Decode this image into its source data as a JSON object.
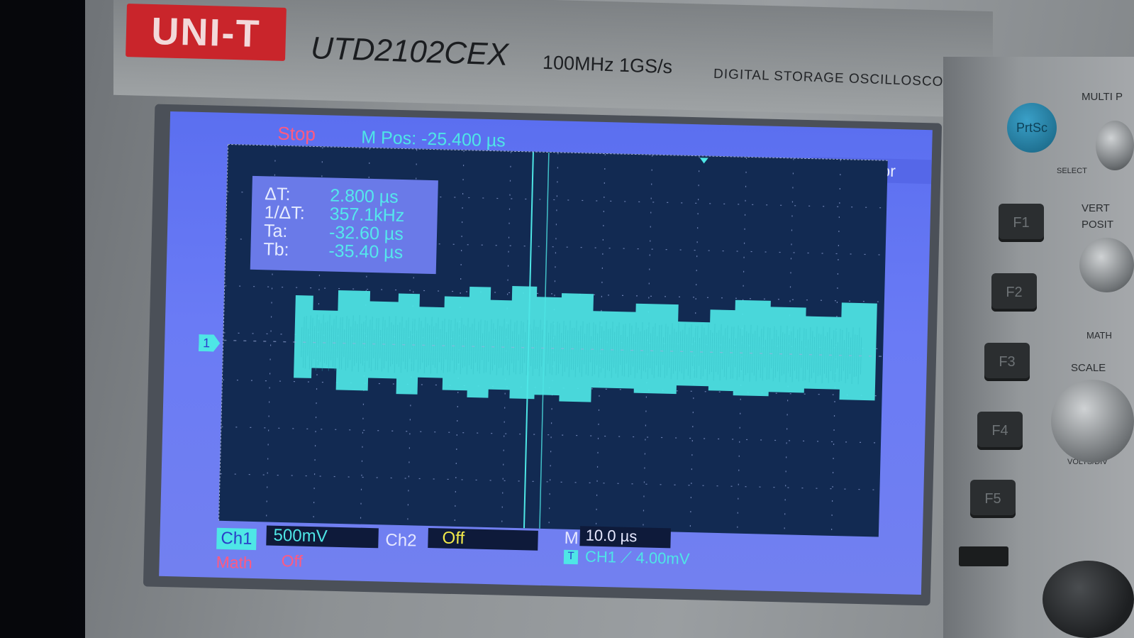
{
  "brand": {
    "logo": "UNI-T",
    "model": "UTD2102CEX",
    "spec": "100MHz  1GS/s",
    "description": "DIGITAL STORAGE OSCILLOSCOPE"
  },
  "screen": {
    "status": "Stop",
    "mpos": "M Pos: -25.400 µs",
    "cursor_tab": "Cursor",
    "readout": {
      "dt_label": "ΔT:",
      "dt_value": "2.800 µs",
      "inv_label": "1/ΔT:",
      "inv_value": "357.1kHz",
      "ta_label": "Ta:",
      "ta_value": "-32.60 µs",
      "tb_label": "Tb:",
      "tb_value": "-35.40 µs"
    },
    "channel_marker": "1",
    "ch1": {
      "label": "Ch1",
      "scale": "500mV"
    },
    "ch2": {
      "label": "Ch2",
      "state": "Off"
    },
    "timebase": {
      "label": "M",
      "value": "10.0 µs"
    },
    "trigger": {
      "icon": "T",
      "text": "CH1 ⟋  4.00mV"
    },
    "math": {
      "label": "Math",
      "state": "Off"
    },
    "trace_color": "#4ee6e6",
    "background_color": "#122a52"
  },
  "panel": {
    "prtsc": "PrtSc",
    "f_buttons": [
      "F1",
      "F2",
      "F3",
      "F4",
      "F5"
    ],
    "labels": {
      "multi": "MULTI P",
      "select": "SELECT",
      "vertical": "VERT",
      "position": "POSIT",
      "math": "MATH",
      "scale": "SCALE",
      "volts": "VOLTS/DIV"
    }
  }
}
